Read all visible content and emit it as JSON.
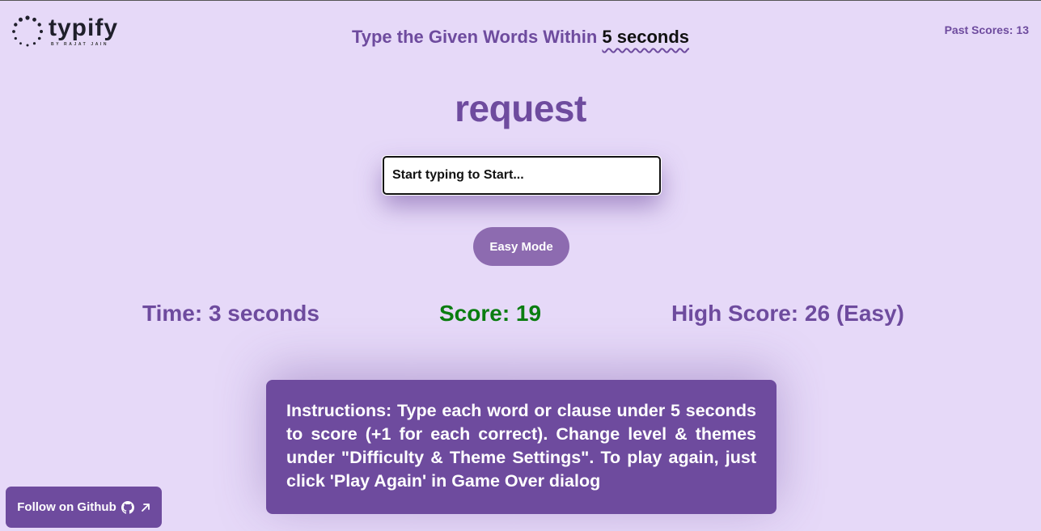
{
  "brand": {
    "name": "typify",
    "byline": "BY RAJAT JAIN",
    "logo_icon": "dotted-circle-logo-icon"
  },
  "header": {
    "prefix": "Type the Given Words Within",
    "time_limit": "5 seconds",
    "past_scores_label": "Past Scores:",
    "past_scores_value": "13"
  },
  "game": {
    "current_word": "request",
    "input_placeholder": "Start typing to Start...",
    "input_value": "",
    "mode_button_label": "Easy Mode"
  },
  "stats": {
    "time": "Time: 3 seconds",
    "score": "Score: 19",
    "high_score": "High Score: 26 (Easy)"
  },
  "instructions": {
    "text": "Instructions: Type each word or clause under 5 seconds to score (+1 for each correct). Change level & themes under \"Difficulty & Theme Settings\". To play again, just click 'Play Again' in Game Over dialog"
  },
  "footer": {
    "github_label": "Follow on Github",
    "github_icon": "github-icon",
    "external_icon": "arrow-up-right-icon"
  },
  "colors": {
    "background": "#e6d9f8",
    "primary": "#6e4b9e",
    "button": "#8d6bb0",
    "score": "#0a7d10"
  }
}
